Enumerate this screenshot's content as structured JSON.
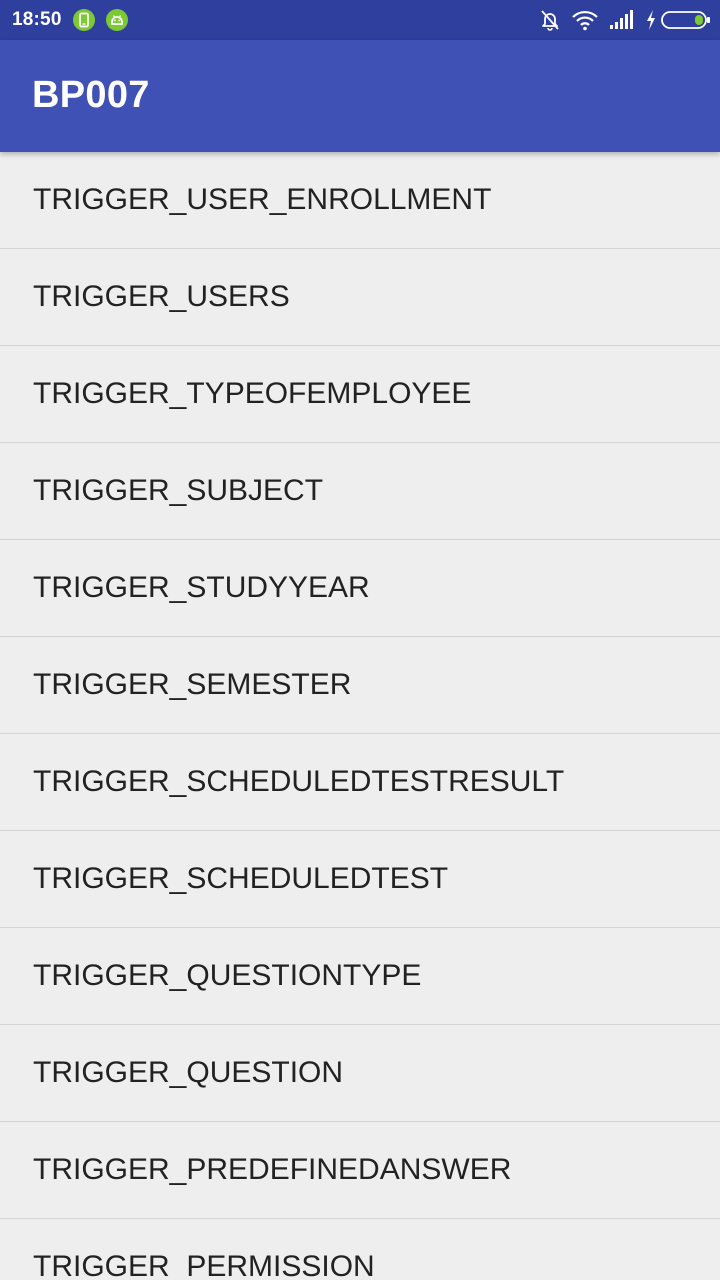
{
  "status_bar": {
    "time": "18:50",
    "icons": [
      "phone-notification-icon",
      "android-notification-icon",
      "silent-bell-icon",
      "wifi-icon",
      "signal-icon",
      "charging-icon",
      "battery-icon"
    ]
  },
  "app_bar": {
    "title": "BP007",
    "color": "#3f51b5"
  },
  "list": {
    "items": [
      {
        "label": "TRIGGER_USER_ENROLLMENT"
      },
      {
        "label": "TRIGGER_USERS"
      },
      {
        "label": "TRIGGER_TYPEOFEMPLOYEE"
      },
      {
        "label": "TRIGGER_SUBJECT"
      },
      {
        "label": "TRIGGER_STUDYYEAR"
      },
      {
        "label": "TRIGGER_SEMESTER"
      },
      {
        "label": "TRIGGER_SCHEDULEDTESTRESULT"
      },
      {
        "label": "TRIGGER_SCHEDULEDTEST"
      },
      {
        "label": "TRIGGER_QUESTIONTYPE"
      },
      {
        "label": "TRIGGER_QUESTION"
      },
      {
        "label": "TRIGGER_PREDEFINEDANSWER"
      },
      {
        "label": "TRIGGER_PERMISSION"
      }
    ]
  }
}
